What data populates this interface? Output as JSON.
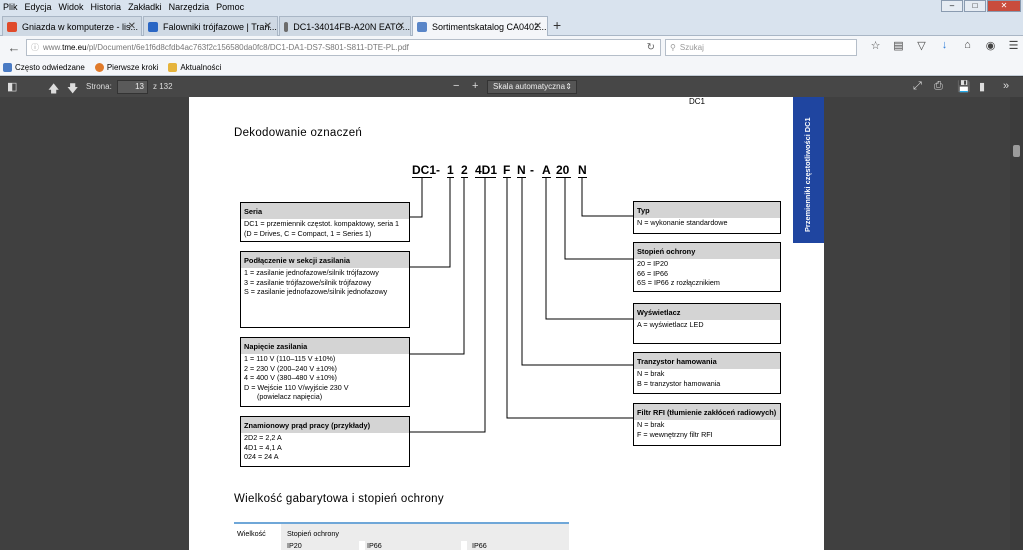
{
  "menubar": {
    "items": [
      "Plik",
      "Edycja",
      "Widok",
      "Historia",
      "Zakładki",
      "Narzędzia",
      "Pomoc"
    ]
  },
  "tabs": [
    {
      "label": "Gniazda w komputerze - lis..."
    },
    {
      "label": "Falowniki trójfazowe | Tran..."
    },
    {
      "label": "DC1-34014FB-A20N EATO..."
    },
    {
      "label": "Sortimentskatalog CA0402..."
    }
  ],
  "navbar": {
    "url_prefix": "www.",
    "url_host": "tme.eu",
    "url_path": "/pl/Document/6e1f6d8cfdb4ac763f2c156580da0fc8/DC1-DA1-DS7-S801-S811-DTE-PL.pdf",
    "search_placeholder": "Szukaj"
  },
  "bookmarks": [
    "Często odwiedzane",
    "Pierwsze kroki",
    "Aktualności"
  ],
  "pdf_toolbar": {
    "page_label": "Strona:",
    "page_value": "13",
    "page_total": "z 132",
    "scale": "Skala automatyczna"
  },
  "document": {
    "header_code": "DC1",
    "side_tab": "Przemienniki częstotliwości DC1",
    "title": "Dekodowanie oznaczeń",
    "code_parts": [
      "DC1",
      "-",
      "1",
      "2",
      "4D1",
      "F",
      "N",
      "-",
      "A",
      "20",
      "N"
    ],
    "left_boxes": [
      {
        "title": "Seria",
        "lines": [
          "DC1 = przemiennik częstot. kompaktowy, seria 1",
          "(D = Drives, C = Compact, 1 = Series 1)"
        ]
      },
      {
        "title": "Podłączenie w sekcji zasilania",
        "lines": [
          "1 = zasilanie jednofazowe/silnik trójfazowy",
          "3 = zasilanie trójfazowe/silnik trójfazowy",
          "S = zasilanie jednofazowe/silnik jednofazowy"
        ]
      },
      {
        "title": "Napięcie zasilania",
        "lines": [
          "1 = 110 V (110–115 V ±10%)",
          "2 = 230 V (200–240 V ±10%)",
          "4 = 400 V (380–480 V ±10%)",
          "D = Wejście 110 V/wyjście 230 V",
          "(powielacz napięcia)"
        ]
      },
      {
        "title": "Znamionowy prąd pracy (przykłady)",
        "lines": [
          "2D2 = 2,2 A",
          "4D1 = 4,1 A",
          "024 = 24 A"
        ]
      }
    ],
    "right_boxes": [
      {
        "title": "Typ",
        "lines": [
          "N = wykonanie standardowe"
        ]
      },
      {
        "title": "Stopień ochrony",
        "lines": [
          "20 = IP20",
          "66 = IP66",
          "6S = IP66 z rozłącznikiem"
        ]
      },
      {
        "title": "Wyświetlacz",
        "lines": [
          "A = wyświetlacz LED"
        ]
      },
      {
        "title": "Tranzystor hamowania",
        "lines": [
          "N = brak",
          "B = tranzystor hamowania"
        ]
      },
      {
        "title": "Filtr RFI (tłumienie zakłóceń radiowych)",
        "lines": [
          "N = brak",
          "F = wewnętrzny filtr RFI"
        ]
      }
    ],
    "section2_title": "Wielkość gabarytowa i stopień ochrony",
    "table": {
      "col1": "Wielkość",
      "col2": "Stopień ochrony",
      "sub": [
        "IP20",
        "IP66",
        "IP66"
      ]
    }
  }
}
